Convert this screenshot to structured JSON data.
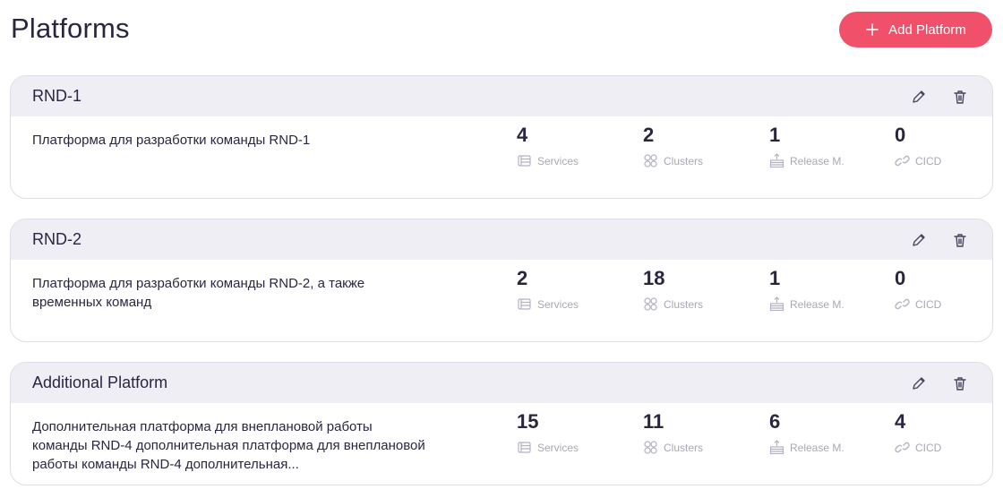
{
  "header": {
    "title": "Platforms",
    "add_button_label": "Add Platform"
  },
  "stat_labels": {
    "services": "Services",
    "clusters": "Clusters",
    "release": "Release M.",
    "cicd": "CICD"
  },
  "platforms": [
    {
      "name": "RND-1",
      "description": "Платформа для разработки команды RND-1",
      "services": "4",
      "clusters": "2",
      "release": "1",
      "cicd": "0"
    },
    {
      "name": "RND-2",
      "description": "Платформа для разработки команды RND-2, а также временных команд",
      "services": "2",
      "clusters": "18",
      "release": "1",
      "cicd": "0"
    },
    {
      "name": "Additional Platform",
      "description": "Дополнительная платформа для внеплановой работы команды RND-4 дополнительная платформа для внеплановой работы команды RND-4 дополнительная...",
      "services": "15",
      "clusters": "11",
      "release": "6",
      "cicd": "4"
    }
  ],
  "colors": {
    "accent": "#f0506a",
    "header_bg": "#efeef5",
    "text": "#2a2640",
    "muted": "#a9a7b8"
  },
  "icons": {
    "add": "plus-icon",
    "edit": "pencil-icon",
    "delete": "trash-icon",
    "services": "services-icon",
    "clusters": "clusters-icon",
    "release": "release-icon",
    "cicd": "cicd-icon"
  }
}
